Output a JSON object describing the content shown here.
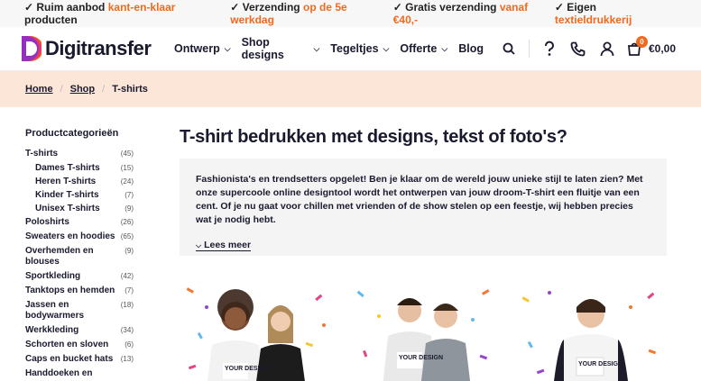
{
  "topbar": {
    "usps": [
      {
        "prefix": "✓ Ruim aanbod ",
        "highlight": "kant-en-klaar",
        "suffix": " producten"
      },
      {
        "prefix": "✓ Verzending ",
        "highlight": "op de 5e werkdag",
        "suffix": ""
      },
      {
        "prefix": "✓ Gratis verzending ",
        "highlight": "vanaf €40,-",
        "suffix": ""
      },
      {
        "prefix": "✓ Eigen ",
        "highlight": "textieldrukkerij",
        "suffix": ""
      }
    ]
  },
  "header": {
    "logo_text": "Digitransfer",
    "nav": [
      "Ontwerp",
      "Shop designs",
      "Tegeltjes",
      "Offerte",
      "Blog"
    ],
    "cart_count": "0",
    "cart_total": "€0,00",
    "icons": [
      "search-icon",
      "help-icon",
      "phone-icon",
      "user-icon",
      "cart-icon"
    ]
  },
  "breadcrumb": {
    "items": [
      "Home",
      "Shop",
      "T-shirts"
    ]
  },
  "sidebar": {
    "title": "Productcategorieën",
    "categories": [
      {
        "label": "T-shirts",
        "count": "(45)",
        "sub": false
      },
      {
        "label": "Dames T-shirts",
        "count": "(15)",
        "sub": true
      },
      {
        "label": "Heren T-shirts",
        "count": "(24)",
        "sub": true
      },
      {
        "label": "Kinder T-shirts",
        "count": "(7)",
        "sub": true
      },
      {
        "label": "Unisex T-shirts",
        "count": "(9)",
        "sub": true
      },
      {
        "label": "Poloshirts",
        "count": "(26)",
        "sub": false
      },
      {
        "label": "Sweaters en hoodies",
        "count": "(65)",
        "sub": false
      },
      {
        "label": "Overhemden en blouses",
        "count": "(9)",
        "sub": false
      },
      {
        "label": "Sportkleding",
        "count": "(42)",
        "sub": false
      },
      {
        "label": "Tanktops en hemden",
        "count": "(7)",
        "sub": false
      },
      {
        "label": "Jassen en bodywarmers",
        "count": "(18)",
        "sub": false
      },
      {
        "label": "Werkkleding",
        "count": "(34)",
        "sub": false
      },
      {
        "label": "Schorten en sloven",
        "count": "(6)",
        "sub": false
      },
      {
        "label": "Caps en bucket hats",
        "count": "(13)",
        "sub": false
      },
      {
        "label": "Handdoeken en",
        "count": "",
        "sub": false
      }
    ]
  },
  "content": {
    "title": "T-shirt bedrukken met designs, tekst of foto's?",
    "intro": "Fashionista's en trendsetters opgelet! Ben je klaar om de wereld jouw unieke stijl te laten zien? Met onze supercoole online designtool wordt het ontwerpen van jouw droom-T-shirt een fluitje van een cent. Of je nu gaat voor chillen met vrienden of de show stelen op een feestje, wij hebben precies wat je nodig hebt.",
    "read_more": "Lees meer"
  },
  "products": [
    {
      "print_text": "YOUR DESIGN"
    },
    {
      "print_text": "YOUR DESIGN"
    },
    {
      "print_text": "YOUR DESIGN"
    }
  ],
  "colors": {
    "accent": "#f06a1d",
    "breadcrumb_bg": "#fbe6d8",
    "text": "#1a1a2e"
  }
}
